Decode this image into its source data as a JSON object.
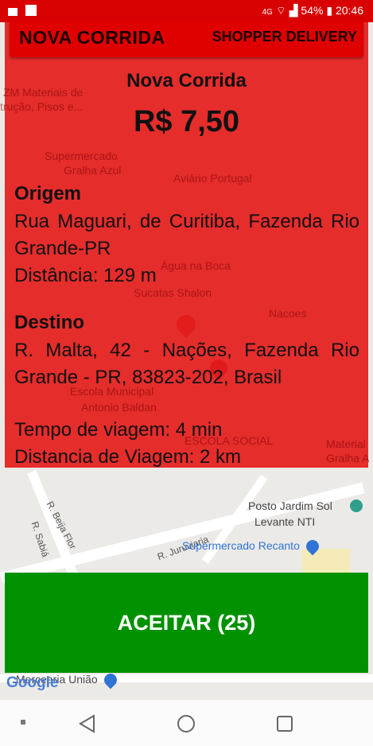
{
  "status_bar": {
    "network": "4G",
    "battery": "54%",
    "time": "20:46"
  },
  "header": {
    "title": "NOVA CORRIDA",
    "app_name": "SHOPPER DELIVERY"
  },
  "card": {
    "title": "Nova Corrida",
    "price": "R$ 7,50",
    "origin": {
      "title": "Origem",
      "address": "Rua Maguari, de Curitiba, Fazenda Rio Grande-PR",
      "distance": "Distância: 129 m"
    },
    "destination": {
      "title": "Destino",
      "address": "R. Malta, 42 - Nações, Fazenda Rio Grande - PR, 83823-202, Brasil",
      "trip_time": "Tempo de viagem: 4 min",
      "trip_distance": "Distancia de Viagem: 2 km"
    }
  },
  "accept_button": {
    "label": "ACEITAR (25)"
  },
  "map": {
    "places": {
      "zm": "ZM Materiais de",
      "zm2": "trução, Pisos e...",
      "supermercado_gralha": "Supermercado",
      "supermercado_gralha2": "Gralha Azul",
      "aviario": "Aviário Portugal",
      "agua": "Água na Boca",
      "sucatas": "Sucatas Shalon",
      "nacoes": "Nacoes",
      "escola_municipal": "Escola Municipal",
      "escola_municipal2": "Antonio Baldan",
      "escola_social": "ESCOLA SOCIAL",
      "material": "Material",
      "material2": "Gralha A",
      "posto": "Posto Jardim Sol",
      "posto2": "Levante NTI",
      "supermercado_recanto": "Supermercado Recanto",
      "mercearia": "Mercearia União"
    },
    "streets": {
      "beija_flor": "R. Beija Flor",
      "sabia": "R. Sabiá",
      "juruviaria": "R. Juruviaria"
    },
    "logo": "Google",
    "colors": {
      "poi_red": "#d84a4a",
      "poi_blue": "#2f73d6",
      "poi_orange": "#e8710a"
    }
  },
  "colors": {
    "status_bar": "#d80000",
    "card": "#e41c1c",
    "accept": "#009100"
  }
}
